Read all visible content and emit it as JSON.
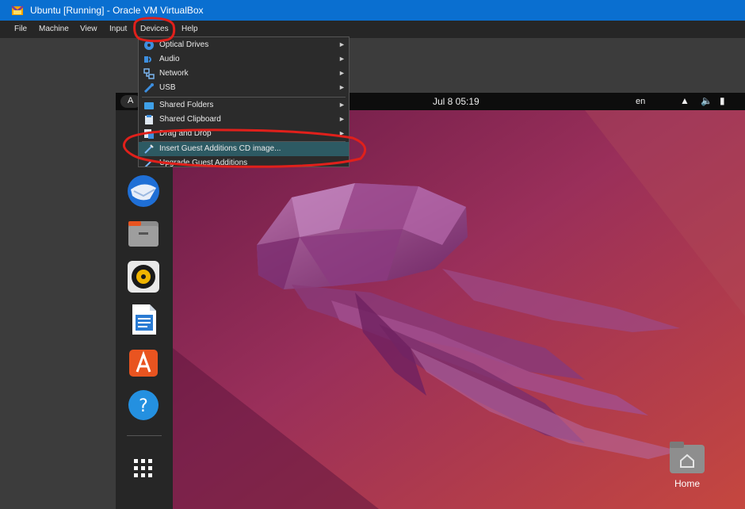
{
  "window": {
    "title": "Ubuntu [Running] - Oracle VM VirtualBox"
  },
  "menubar": {
    "items": [
      "File",
      "Machine",
      "View",
      "Input",
      "Devices",
      "Help"
    ]
  },
  "devices_menu": {
    "items": [
      {
        "label": "Optical Drives",
        "icon": "optical-drive-icon",
        "submenu": true
      },
      {
        "label": "Audio",
        "icon": "audio-icon",
        "submenu": true
      },
      {
        "label": "Network",
        "icon": "network-icon",
        "submenu": true
      },
      {
        "label": "USB",
        "icon": "usb-icon",
        "submenu": true
      },
      {
        "label": "Shared Folders",
        "icon": "shared-folders-icon",
        "submenu": true
      },
      {
        "label": "Shared Clipboard",
        "icon": "shared-clipboard-icon",
        "submenu": true
      },
      {
        "label": "Drag and Drop",
        "icon": "drag-drop-icon",
        "submenu": true
      },
      {
        "label": "Insert Guest Additions CD image...",
        "icon": "cd-insert-icon",
        "submenu": false,
        "highlighted": true
      },
      {
        "label": "Upgrade Guest Additions",
        "icon": "upgrade-icon",
        "submenu": false
      }
    ]
  },
  "guest": {
    "activities": "A",
    "clock": "Jul 8  05:19",
    "input_language": "en​",
    "dock": [
      "thunderbird",
      "files",
      "rhythmbox",
      "libreoffice-writer",
      "app-center",
      "help",
      "show-apps"
    ],
    "desktop_icon": "Home"
  },
  "colors": {
    "titlebar": "#0a6fd0",
    "highlight": "#2d5a63",
    "annotation": "#e0201b",
    "ubuntu_orange": "#e95420"
  }
}
